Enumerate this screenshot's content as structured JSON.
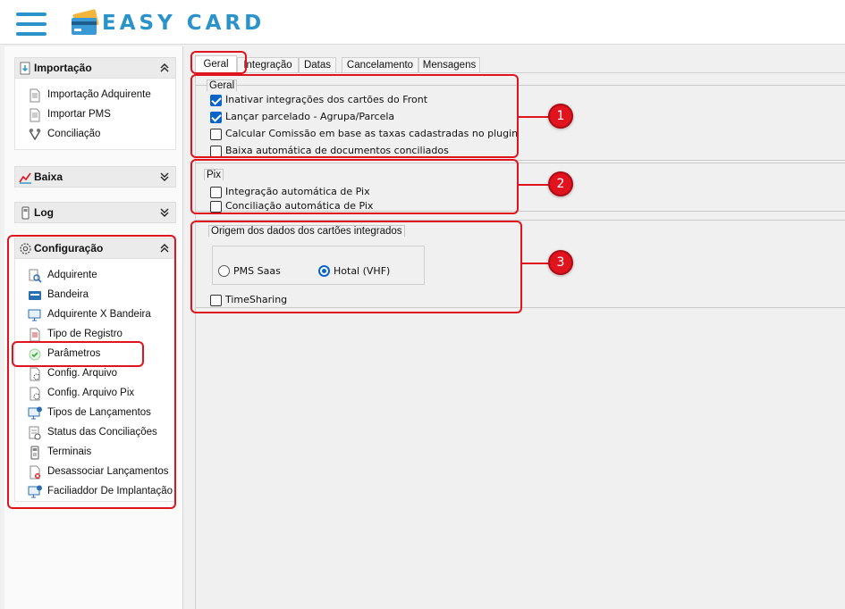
{
  "app": {
    "title": "EASY CARD"
  },
  "sidebar": {
    "groups": [
      {
        "label": "Importação",
        "icon": "import-icon",
        "expanded": true,
        "items": [
          {
            "label": "Importação Adquirente",
            "icon": "document-icon"
          },
          {
            "label": "Importar PMS",
            "icon": "document-icon"
          },
          {
            "label": "Conciliação",
            "icon": "reconcile-icon"
          }
        ]
      },
      {
        "label": "Baixa",
        "icon": "chart-icon",
        "expanded": false,
        "items": []
      },
      {
        "label": "Log",
        "icon": "terminal-icon",
        "expanded": false,
        "items": []
      },
      {
        "label": "Configuração",
        "icon": "gear-icon",
        "expanded": true,
        "items": [
          {
            "label": "Adquirente",
            "icon": "search-doc-icon"
          },
          {
            "label": "Bandeira",
            "icon": "card-icon"
          },
          {
            "label": "Adquirente X Bandeira",
            "icon": "monitor-icon"
          },
          {
            "label": "Tipo de Registro",
            "icon": "document-icon"
          },
          {
            "label": "Parâmetros",
            "icon": "check-circle-icon"
          },
          {
            "label": "Config. Arquivo",
            "icon": "file-gear-icon"
          },
          {
            "label": "Config. Arquivo Pix",
            "icon": "file-gear-icon"
          },
          {
            "label": "Tipos de Lançamentos",
            "icon": "monitor-info-icon"
          },
          {
            "label": "Status das Conciliações",
            "icon": "status-icon"
          },
          {
            "label": "Terminais",
            "icon": "pos-terminal-icon"
          },
          {
            "label": "Desassociar Lançamentos",
            "icon": "doc-remove-icon"
          },
          {
            "label": "Faciliaddor De Implantação",
            "icon": "monitor-info-icon"
          }
        ]
      }
    ]
  },
  "tabs": [
    {
      "label": "Geral",
      "active": true
    },
    {
      "label": "Integração",
      "active": false
    },
    {
      "label": "Datas",
      "active": false
    },
    {
      "label": "Cancelamento",
      "active": false
    },
    {
      "label": "Mensagens",
      "active": false
    }
  ],
  "geral": {
    "title": "Geral",
    "options": [
      {
        "label": "Inativar integrações dos cartões do Front",
        "checked": true
      },
      {
        "label": "Lançar parcelado - Agrupa/Parcela",
        "checked": true
      },
      {
        "label": "Calcular Comissão em base as taxas cadastradas no plugin",
        "checked": false
      },
      {
        "label": "Baixa automática de documentos conciliados",
        "checked": false
      }
    ]
  },
  "pix": {
    "title": "Pix",
    "options": [
      {
        "label": "Integração automática de Pix",
        "checked": false
      },
      {
        "label": "Conciliação automática de Pix",
        "checked": false
      }
    ]
  },
  "origem": {
    "title": "Origem dos dados dos cartões integrados",
    "radios": [
      {
        "label": "PMS Saas",
        "selected": false
      },
      {
        "label": "Hotal (VHF)",
        "selected": true
      }
    ],
    "timesharing": {
      "label": "TimeSharing",
      "checked": false
    }
  },
  "callouts": [
    "1",
    "2",
    "3"
  ],
  "colors": {
    "accent": "#2a93c9",
    "highlight": "#e0141e",
    "check": "#0a64c8"
  }
}
